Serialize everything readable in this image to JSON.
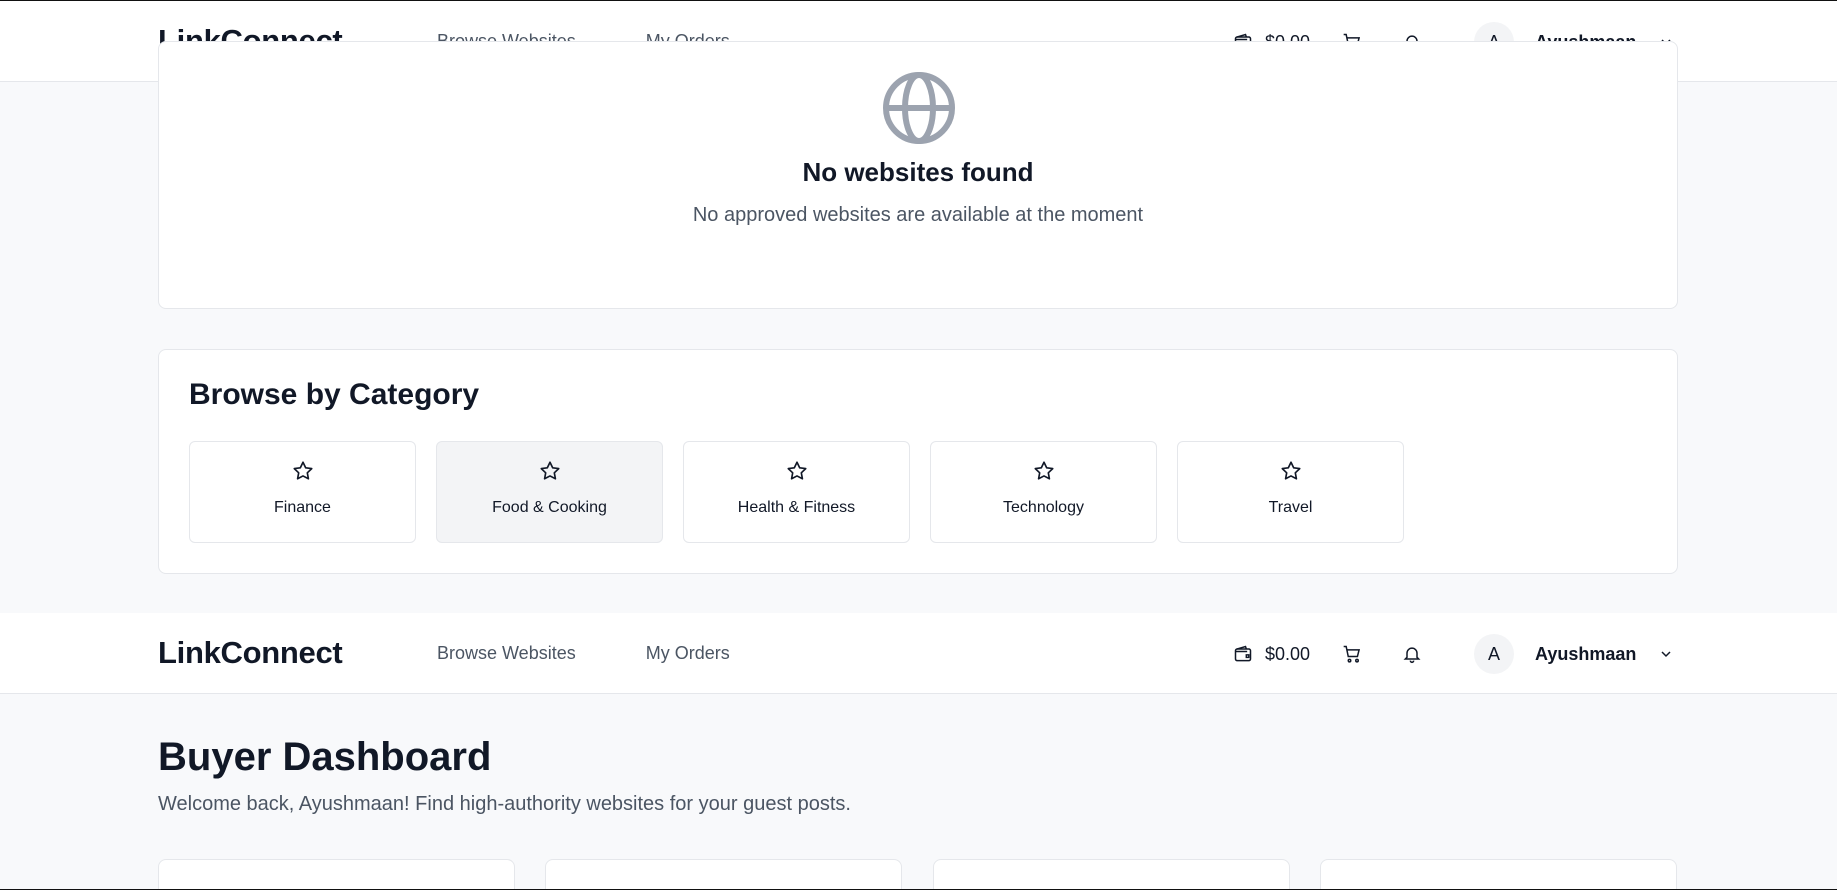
{
  "header": {
    "logo": "LinkConnect",
    "nav": [
      "Browse Websites",
      "My Orders"
    ],
    "wallet_balance": "$0.00",
    "avatar_initial": "A",
    "username": "Ayushmaan",
    "icons": [
      "wallet-icon",
      "cart-icon",
      "bell-icon",
      "chevron-down-icon"
    ]
  },
  "empty_state": {
    "icon": "globe-icon",
    "title": "No websites found",
    "subtitle": "No approved websites are available at the moment"
  },
  "categories": {
    "title": "Browse by Category",
    "items": [
      {
        "label": "Finance",
        "icon": "star-icon"
      },
      {
        "label": "Food & Cooking",
        "icon": "star-icon",
        "selected": true
      },
      {
        "label": "Health & Fitness",
        "icon": "star-icon"
      },
      {
        "label": "Technology",
        "icon": "star-icon"
      },
      {
        "label": "Travel",
        "icon": "star-icon"
      }
    ]
  },
  "dashboard": {
    "title": "Buyer Dashboard",
    "subtitle": "Welcome back, Ayushmaan! Find high-authority websites for your guest posts."
  },
  "colors": {
    "background": "#f8f9fb",
    "card": "#ffffff",
    "border": "#e5e7eb",
    "text": "#111827",
    "muted": "#4b5563",
    "selected_tile": "#f3f4f6"
  }
}
